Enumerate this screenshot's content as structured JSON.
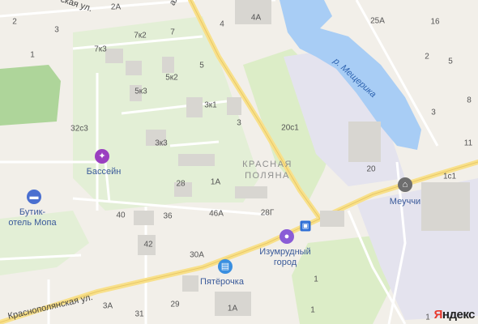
{
  "map": {
    "streets": {
      "top_left": "ская ул.",
      "top_center": "ая ул.",
      "krasnopolyanskaya": "Краснополянская ул."
    },
    "district": "КРАСНАЯ\nПОЛЯНА",
    "river": "р. Мещерика",
    "house_numbers": [
      "2",
      "2А",
      "3",
      "1",
      "7к2",
      "7",
      "4",
      "4А",
      "7к3",
      "5",
      "5к2",
      "5к3",
      "3к1",
      "3",
      "32с3",
      "3к3",
      "20с1",
      "28",
      "1А",
      "40",
      "36",
      "46А",
      "28Г",
      "42",
      "30А",
      "3А",
      "31",
      "29",
      "1А",
      "1",
      "25А",
      "16",
      "2",
      "8",
      "3",
      "5",
      "11",
      "1с1",
      "20",
      "1",
      "1"
    ],
    "pois": [
      {
        "name": "Бассейн",
        "icon": "dumbbell-icon",
        "color": "#9a3fc0"
      },
      {
        "name": "Бутик-\nотель Мопа",
        "icon": "bed-icon",
        "color": "#4a6fd0"
      },
      {
        "name": "Изумрудный\nгород",
        "icon": "ball-icon",
        "color": "#8a5cd6"
      },
      {
        "name": "Пятёрочка",
        "icon": "basket-icon",
        "color": "#3a8fe0"
      },
      {
        "name": "Меуччи",
        "icon": "factory-icon",
        "color": "#6e6e6e"
      }
    ],
    "transit_stop": "bus-stop-icon",
    "attribution": {
      "first": "Я",
      "rest": "ндекс"
    },
    "colors": {
      "background": "#f2efe9",
      "park": "#dcedc7",
      "forest": "#aed59a",
      "water": "#a8cdf5",
      "road_major": "#f8e08a",
      "industrial": "#e4e3ee"
    }
  }
}
